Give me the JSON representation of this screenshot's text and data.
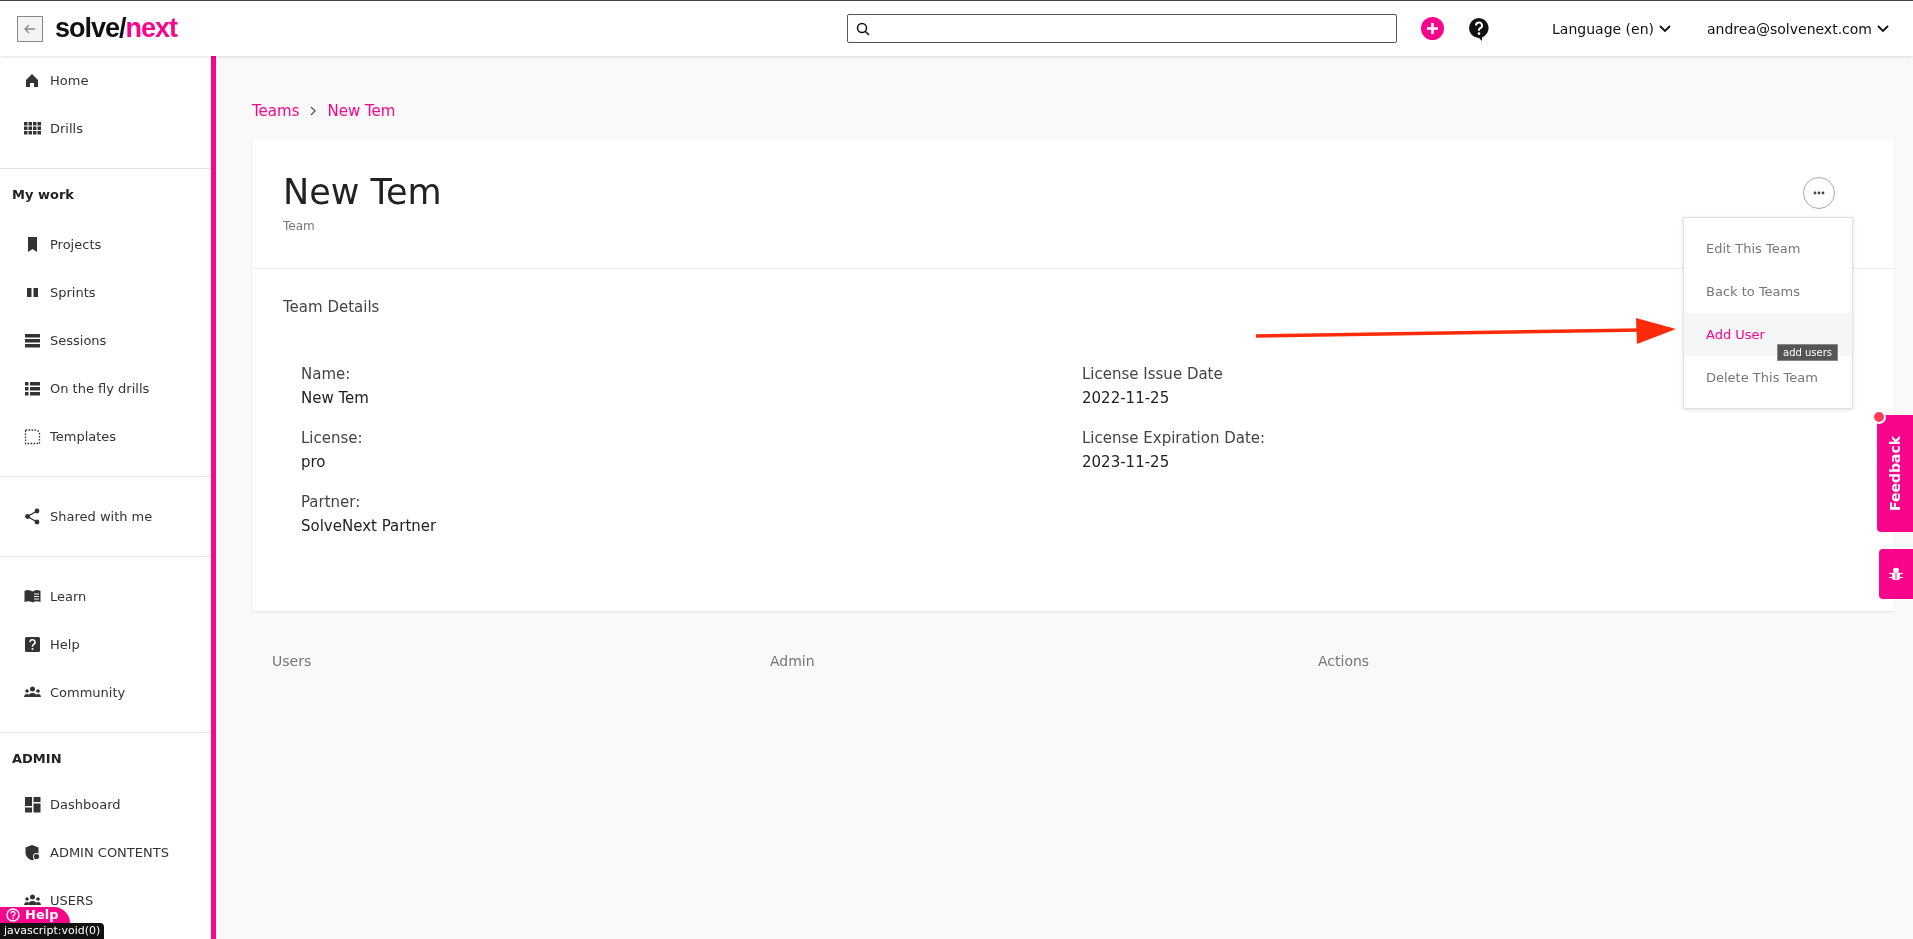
{
  "topbar": {
    "logo": [
      "solve/",
      "next"
    ],
    "language": "Language (en)",
    "user": "andrea@solvenext.com"
  },
  "sidebar": {
    "sections": [
      {
        "items": [
          {
            "label": "Home"
          },
          {
            "label": "Drills"
          }
        ]
      },
      {
        "heading": "My work",
        "items": [
          {
            "label": "Projects"
          },
          {
            "label": "Sprints"
          },
          {
            "label": "Sessions"
          },
          {
            "label": "On the fly drills"
          },
          {
            "label": "Templates"
          }
        ]
      },
      {
        "items": [
          {
            "label": "Shared with me"
          }
        ]
      },
      {
        "items": [
          {
            "label": "Learn"
          },
          {
            "label": "Help"
          },
          {
            "label": "Community"
          }
        ]
      },
      {
        "heading": "ADMIN",
        "items": [
          {
            "label": "Dashboard"
          },
          {
            "label": "ADMIN CONTENTS"
          },
          {
            "label": "USERS"
          }
        ]
      }
    ]
  },
  "breadcrumb": [
    "Teams",
    "New Tem"
  ],
  "team": {
    "title": "New Tem",
    "subtitle": "Team",
    "section_title": "Team Details",
    "fields": [
      [
        {
          "label": "Name:",
          "value": "New Tem"
        },
        {
          "label": "License:",
          "value": "pro"
        },
        {
          "label": "Partner:",
          "value": "SolveNext Partner"
        }
      ],
      [
        {
          "label": "License Issue Date",
          "value": "2022-11-25"
        },
        {
          "label": "License Expiration Date:",
          "value": "2023-11-25"
        }
      ]
    ]
  },
  "menu": {
    "items": [
      {
        "label": "Edit This Team",
        "highlighted": false
      },
      {
        "label": "Back to Teams",
        "highlighted": false
      },
      {
        "label": "Add User",
        "highlighted": true
      },
      {
        "label": "Delete This Team",
        "highlighted": false
      }
    ],
    "tooltip": "add users"
  },
  "table": {
    "columns": [
      "Users",
      "Admin",
      "Actions"
    ]
  },
  "feedback": {
    "label": "Feedback"
  },
  "help_button": {
    "label": "Help"
  },
  "status_url": "javascript:void(0)"
}
